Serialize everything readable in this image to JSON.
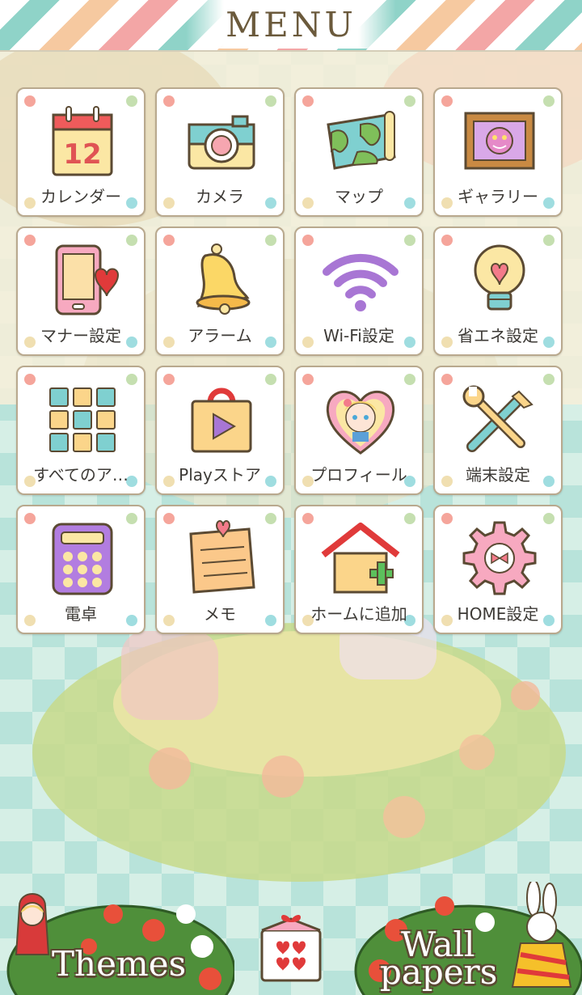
{
  "header": {
    "title": "MENU"
  },
  "apps": [
    {
      "label": "カレンダー",
      "icon": "calendar-icon",
      "text": "12"
    },
    {
      "label": "カメラ",
      "icon": "camera-icon"
    },
    {
      "label": "マップ",
      "icon": "map-icon"
    },
    {
      "label": "ギャラリー",
      "icon": "gallery-icon"
    },
    {
      "label": "マナー設定",
      "icon": "manner-mode-icon"
    },
    {
      "label": "アラーム",
      "icon": "alarm-bell-icon"
    },
    {
      "label": "Wi-Fi設定",
      "icon": "wifi-icon"
    },
    {
      "label": "省エネ設定",
      "icon": "light-bulb-icon"
    },
    {
      "label": "すべてのア…",
      "icon": "app-grid-icon"
    },
    {
      "label": "Playストア",
      "icon": "play-store-icon"
    },
    {
      "label": "プロフィール",
      "icon": "profile-icon"
    },
    {
      "label": "端末設定",
      "icon": "tools-icon"
    },
    {
      "label": "電卓",
      "icon": "calculator-icon"
    },
    {
      "label": "メモ",
      "icon": "memo-icon"
    },
    {
      "label": "ホームに追加",
      "icon": "add-home-icon"
    },
    {
      "label": "HOME設定",
      "icon": "home-settings-gear-icon"
    }
  ],
  "bottom": {
    "themes_label": "Themes",
    "wall_label_1": "Wall",
    "wall_label_2": "papers",
    "center_icon": "gift-box-icon"
  },
  "colors": {
    "tile_border": "#b9a98e",
    "dot_red": "#f5a59b",
    "dot_green": "#c5dfb0",
    "dot_yellow": "#f0dfb1",
    "dot_blue": "#9fdde0",
    "title": "#6b5a3c"
  }
}
